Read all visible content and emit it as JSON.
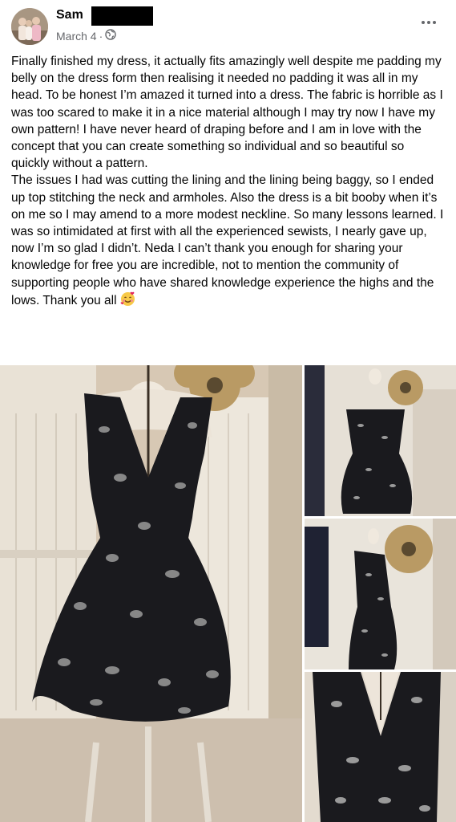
{
  "post": {
    "author": "Sam",
    "date": "March 4",
    "audience_icon": "public-globe-icon",
    "more_icon": "more-options-icon",
    "paragraph1": "Finally finished my dress, it actually fits amazingly well despite me padding my belly on the dress form then realising it needed no padding it was all in my head. To be honest I’m amazed it turned into a dress. The fabric is horrible as I was too scared to make it in a nice material although I may try now I have my own pattern! I have never heard of draping before and I am in love with the concept that you can create something so individual and so beautiful so quickly without a pattern.",
    "paragraph2": "The issues I had was cutting the lining and the lining being baggy, so I ended up top stitching the neck and armholes. Also the dress is a bit booby when it’s on me so I may amend to a more modest neckline. So many lessons learned. I was so intimidated at first with all the experienced sewists, I nearly gave up, now I’m so glad I didn’t. Neda I can’t thank you enough for sharing your knowledge for free you are incredible, not to mention the community of supporting people who have shared knowledge experience the highs and the lows. Thank you all",
    "emoji": "smiling-face-with-hearts-emoji"
  },
  "photos": [
    {
      "label": "dress-front-photo"
    },
    {
      "label": "dress-front-small-photo"
    },
    {
      "label": "dress-side-photo"
    },
    {
      "label": "dress-neckline-closeup-photo"
    }
  ]
}
